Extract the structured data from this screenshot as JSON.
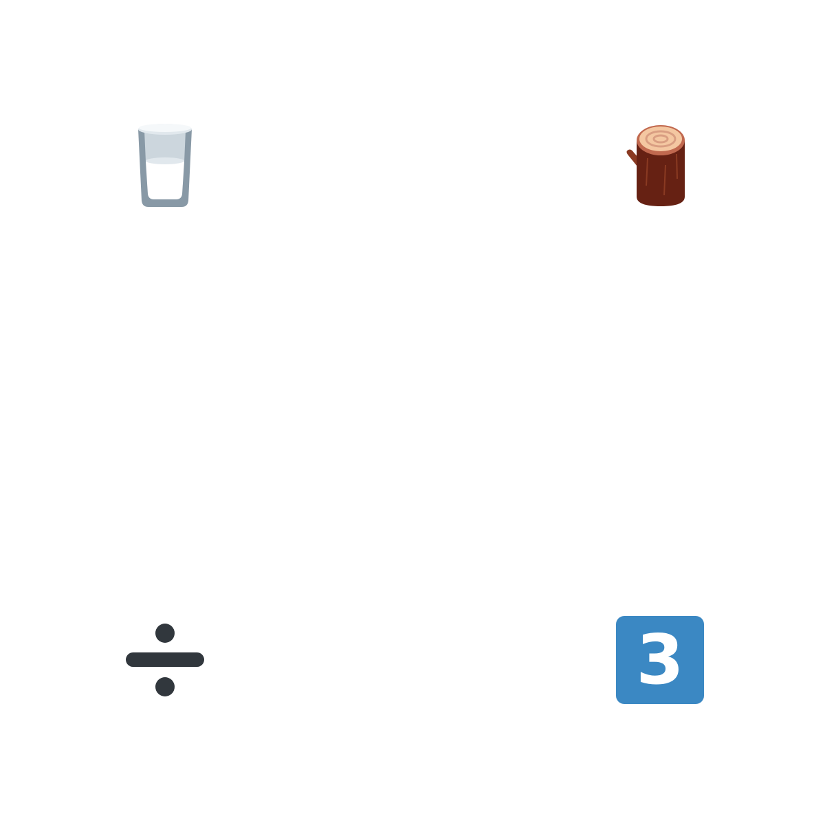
{
  "icons": [
    {
      "name": "glass-of-milk-icon",
      "position": "top-left"
    },
    {
      "name": "wood-log-icon",
      "position": "top-right"
    },
    {
      "name": "division-sign-icon",
      "position": "bottom-left"
    },
    {
      "name": "keycap-digit-three-icon",
      "position": "bottom-right"
    }
  ],
  "keycap": {
    "digit": "3",
    "color": "#3B88C3"
  },
  "colors": {
    "background": "#FFFFFF",
    "glass_rim": "#E1E8ED",
    "glass_body": "#8899A6",
    "milk": "#FFFFFF",
    "log_bark": "#662113",
    "log_top": "#C1694F",
    "log_rings": "#F4C7A1",
    "divide": "#31373D"
  }
}
